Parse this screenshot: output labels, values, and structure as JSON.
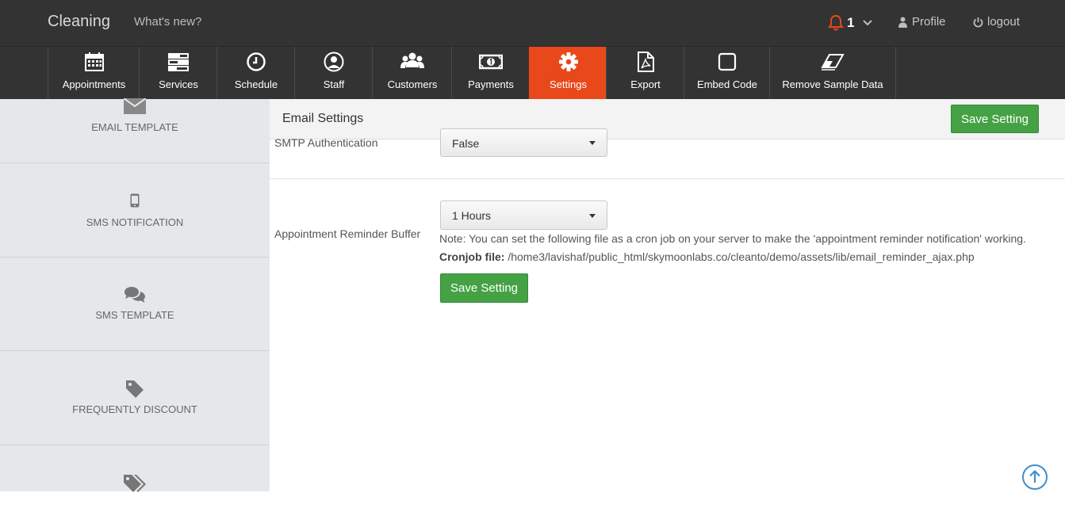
{
  "header": {
    "brand": "Cleaning",
    "whats_new": "What's new?",
    "notification_count": "1",
    "profile_label": "Profile",
    "logout_label": "logout"
  },
  "nav": {
    "items": [
      {
        "label": "Appointments",
        "icon": "calendar-icon"
      },
      {
        "label": "Services",
        "icon": "list-icon"
      },
      {
        "label": "Schedule",
        "icon": "clock-icon"
      },
      {
        "label": "Staff",
        "icon": "user-icon"
      },
      {
        "label": "Customers",
        "icon": "users-icon"
      },
      {
        "label": "Payments",
        "icon": "money-icon"
      },
      {
        "label": "Settings",
        "icon": "gear-icon",
        "active": true
      },
      {
        "label": "Export",
        "icon": "pdf-file-icon"
      },
      {
        "label": "Embed Code",
        "icon": "square-icon"
      },
      {
        "label": "Remove Sample Data",
        "icon": "eraser-icon"
      }
    ]
  },
  "sidebar": {
    "items": [
      {
        "label": "EMAIL TEMPLATE",
        "icon": "envelope-icon"
      },
      {
        "label": "SMS NOTIFICATION",
        "icon": "mobile-icon"
      },
      {
        "label": "SMS TEMPLATE",
        "icon": "comments-icon"
      },
      {
        "label": "FREQUENTLY DISCOUNT",
        "icon": "tag-icon"
      },
      {
        "label": "",
        "icon": "tags-icon"
      }
    ]
  },
  "panel": {
    "title": "Email Settings",
    "save_label": "Save Setting",
    "smtp_auth_label": "SMTP Authentication",
    "smtp_auth_value": "False",
    "reminder_label": "Appointment Reminder Buffer",
    "reminder_value": "1 Hours",
    "note": "Note: You can set the following file as a cron job on your server to make the 'appointment reminder notification' working.",
    "cron_label": "Cronjob file:",
    "cron_path": "/home3/lavishaf/public_html/skymoonlabs.co/cleanto/demo/assets/lib/email_reminder_ajax.php",
    "save_bottom_label": "Save Setting"
  },
  "colors": {
    "topbar": "#333333",
    "active_nav": "#e8481a",
    "sidebar_bg": "#e5e8eb",
    "save_green": "#45a244",
    "bell_red": "#e8481a",
    "scroll_blue": "#3f8ed0"
  }
}
